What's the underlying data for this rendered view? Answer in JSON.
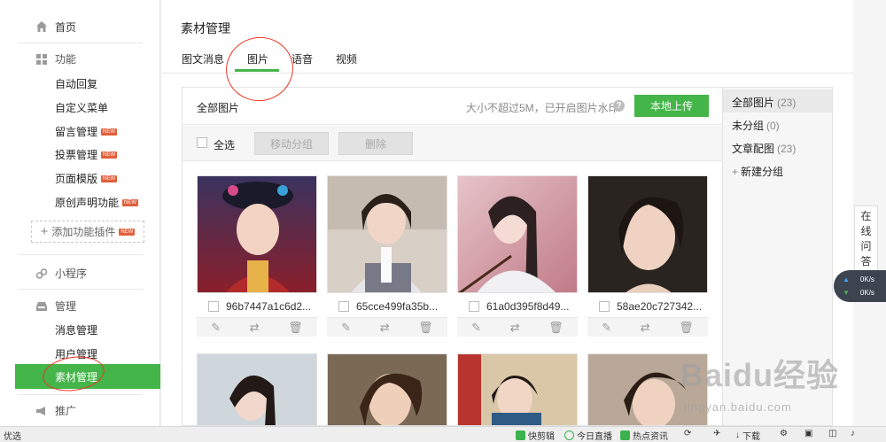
{
  "sidebar": {
    "home": "首页",
    "function_section": "功能",
    "function_items": [
      {
        "label": "自动回复",
        "new": false
      },
      {
        "label": "自定义菜单",
        "new": false
      },
      {
        "label": "留言管理",
        "new": true
      },
      {
        "label": "投票管理",
        "new": true
      },
      {
        "label": "页面模版",
        "new": true
      },
      {
        "label": "原创声明功能",
        "new": true
      }
    ],
    "new_tag": "NEW",
    "add_plugin": "添加功能插件",
    "miniprogram": "小程序",
    "manage_section": "管理",
    "manage_items": [
      "消息管理",
      "用户管理",
      "素材管理"
    ],
    "promote": "推广"
  },
  "header": {
    "title": "素材管理",
    "tabs": [
      "图文消息",
      "图片",
      "语音",
      "视频"
    ],
    "active_tab": "图片"
  },
  "content": {
    "title": "全部图片",
    "hint": "大小不超过5M，已开启图片水印",
    "upload_button": "本地上传",
    "select_all": "全选",
    "move_group_button": "移动分组",
    "delete_button": "删除",
    "images": [
      {
        "name": "96b7447a1c6d2..."
      },
      {
        "name": "65cce499fa35b..."
      },
      {
        "name": "61a0d395f8d49..."
      },
      {
        "name": "58ae20c727342..."
      },
      {
        "name": ""
      },
      {
        "name": ""
      },
      {
        "name": ""
      },
      {
        "name": ""
      }
    ]
  },
  "groups": [
    {
      "label": "全部图片",
      "count": "(23)"
    },
    {
      "label": "未分组",
      "count": "(0)"
    },
    {
      "label": "文章配图",
      "count": "(23)"
    }
  ],
  "new_group": "新建分组",
  "online_help": "在线问答",
  "speed": {
    "up": "0K/s",
    "down": "0K/s"
  },
  "statusbar": {
    "left": "优选",
    "items": [
      "快剪辑",
      "今日直播",
      "热点资讯",
      "下载"
    ]
  },
  "watermark": {
    "logo": "Baidu经验",
    "url": "jingyan.baidu.com"
  },
  "colors": {
    "accent": "#44b549",
    "new_tag": "#e15f3c"
  }
}
